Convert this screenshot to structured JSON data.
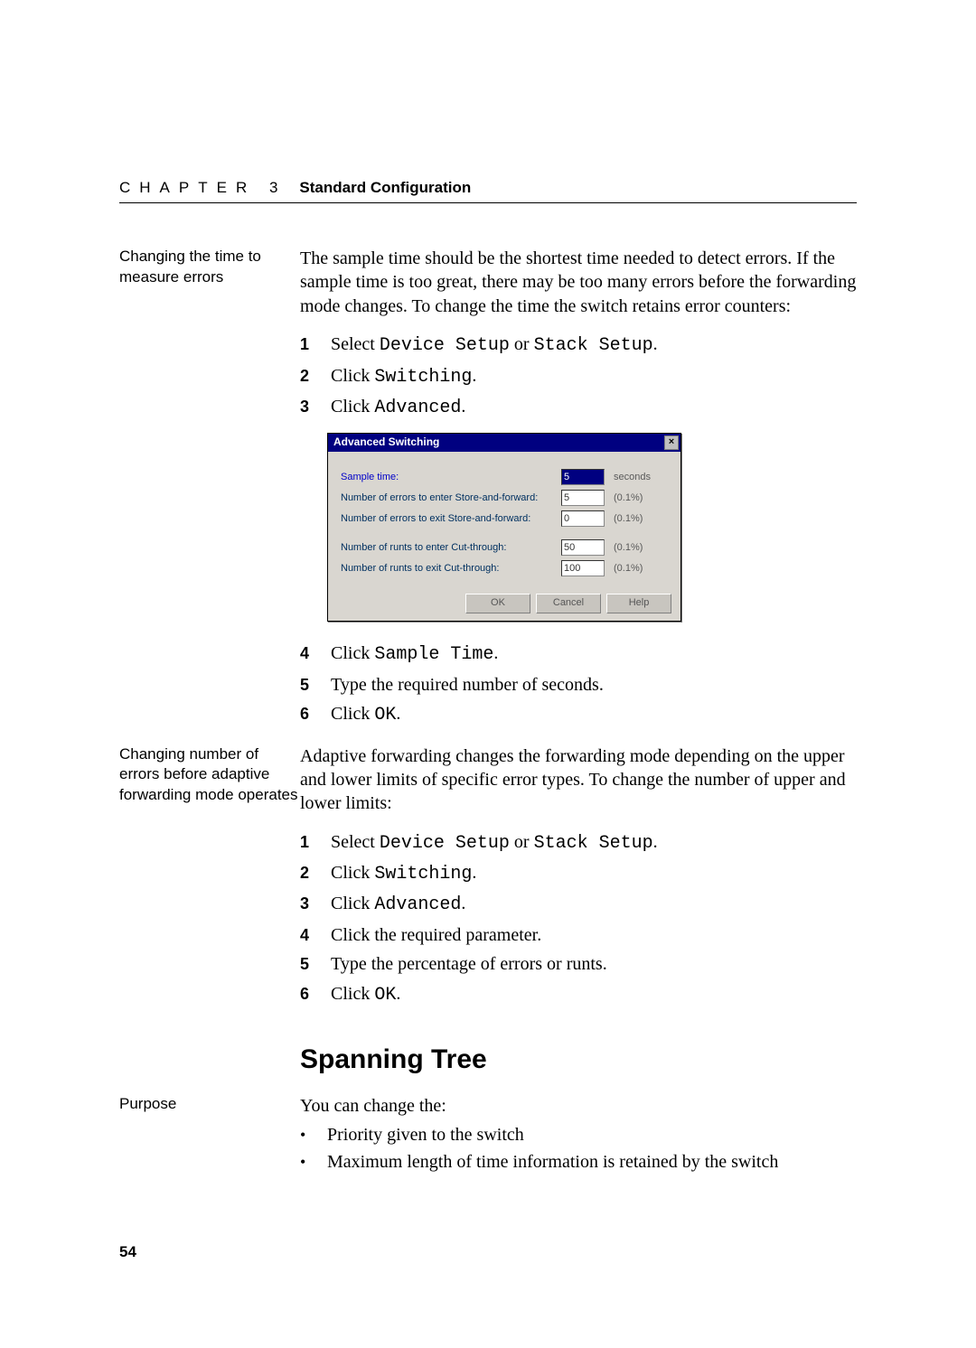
{
  "header": {
    "chapter": "CHAPTER 3",
    "title": "Standard Configuration"
  },
  "sec1": {
    "side": "Changing the time to measure errors",
    "intro": "The sample time should be the shortest time needed to detect errors. If the sample time is too great, there may be too many errors before the forwarding mode changes. To change the time the switch retains error counters:",
    "steps": [
      {
        "n": "1",
        "pre": "Select ",
        "m": "Device Setup",
        "mid": " or ",
        "m2": "Stack Setup",
        "post": "."
      },
      {
        "n": "2",
        "pre": "Click ",
        "m": "Switching",
        "post": "."
      },
      {
        "n": "3",
        "pre": "Click ",
        "m": "Advanced",
        "post": "."
      }
    ],
    "steps2": [
      {
        "n": "4",
        "pre": "Click ",
        "m": "Sample Time",
        "post": "."
      },
      {
        "n": "5",
        "text": "Type the required number of seconds."
      },
      {
        "n": "6",
        "pre": "Click ",
        "m": "OK",
        "post": "."
      }
    ]
  },
  "dialog": {
    "title": "Advanced Switching",
    "rows": [
      {
        "label": "Sample time:",
        "value": "5",
        "unit": "seconds",
        "hi": true
      },
      {
        "label": "Number of errors to enter Store-and-forward:",
        "value": "5",
        "unit": "(0.1%)"
      },
      {
        "label": "Number of errors to exit Store-and-forward:",
        "value": "0",
        "unit": "(0.1%)"
      },
      {
        "label": "Number of runts to enter Cut-through:",
        "value": "50",
        "unit": "(0.1%)",
        "grp": true
      },
      {
        "label": "Number of runts to exit Cut-through:",
        "value": "100",
        "unit": "(0.1%)"
      }
    ],
    "buttons": {
      "ok": "OK",
      "cancel": "Cancel",
      "help": "Help"
    }
  },
  "sec2": {
    "side": "Changing number of errors before adaptive forwarding mode operates",
    "intro": "Adaptive forwarding changes the forwarding mode depending on the upper and lower limits of specific error types. To change the number of upper and lower limits:",
    "steps": [
      {
        "n": "1",
        "pre": "Select ",
        "m": "Device Setup",
        "mid": " or ",
        "m2": "Stack Setup",
        "post": "."
      },
      {
        "n": "2",
        "pre": "Click ",
        "m": "Switching",
        "post": "."
      },
      {
        "n": "3",
        "pre": "Click ",
        "m": "Advanced",
        "post": "."
      },
      {
        "n": "4",
        "text": "Click the required parameter."
      },
      {
        "n": "5",
        "text": "Type the percentage of errors or runts."
      },
      {
        "n": "6",
        "pre": "Click ",
        "m": "OK",
        "post": "."
      }
    ]
  },
  "spanning": {
    "heading": "Spanning Tree",
    "side": "Purpose",
    "intro": "You can change the:",
    "bullets": [
      "Priority given to the switch",
      "Maximum length of time information is retained by the switch"
    ]
  },
  "page_number": "54"
}
